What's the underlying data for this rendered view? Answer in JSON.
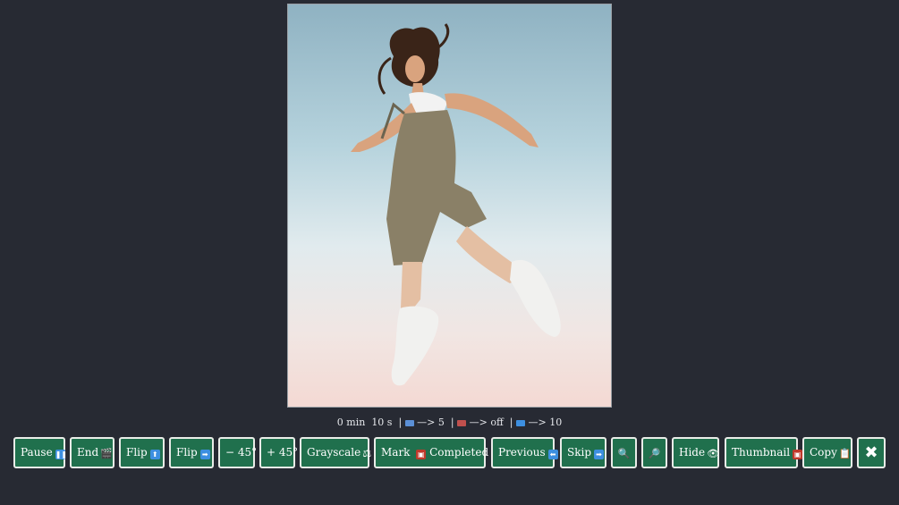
{
  "viewer": {
    "image_alt": "Woman jumping in the air against a pale sky"
  },
  "status": {
    "time_min": "0 min",
    "time_sec": "10 s",
    "sep": "|",
    "value_a": "—> 5",
    "value_b": "—> off",
    "value_c": "—> 10"
  },
  "toolbar": {
    "pause": "Pause",
    "end": "End",
    "flip_v": "Flip",
    "flip_h": "Flip",
    "rot_minus": "− 45°",
    "rot_plus": "+ 45°",
    "grayscale": "Grayscale",
    "mark": "Mark",
    "completed": "Completed",
    "previous": "Previous",
    "skip": "Skip",
    "hide": "Hide",
    "thumbnail": "Thumbnail",
    "copy": "Copy",
    "close": "✖"
  },
  "icons": {
    "pause": "pause-icon",
    "end": "clapperboard-icon",
    "flip_v": "arrow-up-icon",
    "flip_h": "arrow-right-icon",
    "grayscale": "scales-icon",
    "mark": "image-icon",
    "completed": "checkmark-icon",
    "previous": "arrow-left-icon",
    "skip": "arrow-right-icon",
    "zoom_in": "zoom-in-icon",
    "zoom_out": "zoom-out-icon",
    "hide": "eye-icon",
    "thumbnail": "image-icon",
    "copy": "clipboard-icon",
    "close": "close-icon"
  },
  "colors": {
    "background": "#272a33",
    "button": "#20704d",
    "button_border": "#e9ece8"
  }
}
